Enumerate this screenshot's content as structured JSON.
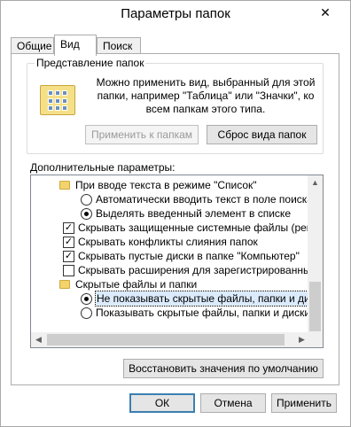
{
  "window": {
    "title": "Параметры папок"
  },
  "tabs": [
    {
      "label": "Общие"
    },
    {
      "label": "Вид"
    },
    {
      "label": "Поиск"
    }
  ],
  "folder_views": {
    "legend": "Представление папок",
    "description": "Можно применить вид, выбранный для этой папки, например \"Таблица\" или \"Значки\", ко всем папкам этого типа.",
    "apply_button": "Применить к папкам",
    "reset_button": "Сброс вида папок"
  },
  "advanced": {
    "label": "Дополнительные параметры:",
    "items": [
      {
        "type": "folder",
        "indent": 1,
        "text": "При вводе текста в режиме \"Список\""
      },
      {
        "type": "radio",
        "indent": 2,
        "checked": false,
        "text": "Автоматически вводить текст в поле поиска"
      },
      {
        "type": "radio",
        "indent": 2,
        "checked": true,
        "text": "Выделять введенный элемент в списке"
      },
      {
        "type": "checkbox",
        "indent": 1,
        "checked": true,
        "text": "Скрывать защищенные системные файлы (рекомен"
      },
      {
        "type": "checkbox",
        "indent": 1,
        "checked": true,
        "text": "Скрывать конфликты слияния папок"
      },
      {
        "type": "checkbox",
        "indent": 1,
        "checked": true,
        "text": "Скрывать пустые диски в папке \"Компьютер\""
      },
      {
        "type": "checkbox",
        "indent": 1,
        "checked": false,
        "text": "Скрывать расширения для зарегистрированных типо"
      },
      {
        "type": "folder",
        "indent": 1,
        "text": "Скрытые файлы и папки"
      },
      {
        "type": "radio",
        "indent": 2,
        "checked": true,
        "selected": true,
        "text": "Не показывать скрытые файлы, папки и диски"
      },
      {
        "type": "radio",
        "indent": 2,
        "checked": false,
        "text": "Показывать скрытые файлы, папки и диски"
      }
    ]
  },
  "restore_button": "Восстановить значения по умолчанию",
  "footer": {
    "ok": "ОК",
    "cancel": "Отмена",
    "apply": "Применить"
  },
  "icons": {
    "close": "close-icon",
    "folder": "folder-icon",
    "check": "✓"
  },
  "colors": {
    "selection": "#dcebfc",
    "default_button_border": "#3c7fb1",
    "folder_yellow": "#f3d36d"
  }
}
